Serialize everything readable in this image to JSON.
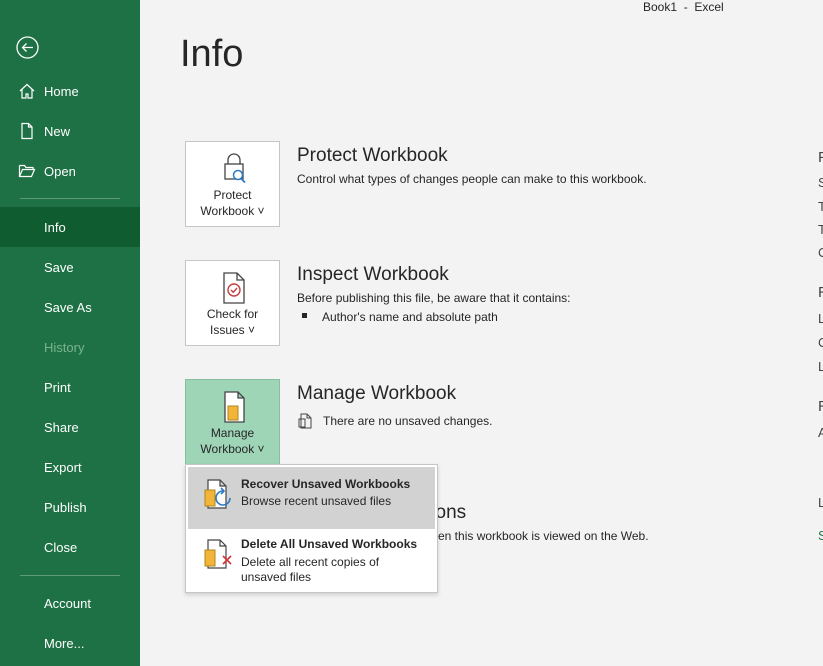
{
  "window": {
    "title": "Book1  -  Excel"
  },
  "page": {
    "title": "Info"
  },
  "sidebar": {
    "items": [
      {
        "label": "Home"
      },
      {
        "label": "New"
      },
      {
        "label": "Open"
      },
      {
        "label": "Info"
      },
      {
        "label": "Save"
      },
      {
        "label": "Save As"
      },
      {
        "label": "History"
      },
      {
        "label": "Print"
      },
      {
        "label": "Share"
      },
      {
        "label": "Export"
      },
      {
        "label": "Publish"
      },
      {
        "label": "Close"
      },
      {
        "label": "Account"
      },
      {
        "label": "More..."
      }
    ]
  },
  "sections": {
    "protect": {
      "button_line1": "Protect",
      "button_line2": "Workbook ˅",
      "title": "Protect Workbook",
      "description": "Control what types of changes people can make to this workbook."
    },
    "inspect": {
      "button_line1": "Check for",
      "button_line2": "Issues ˅",
      "title": "Inspect Workbook",
      "description": "Before publishing this file, be aware that it contains:",
      "bullets": [
        "Author's name and absolute path"
      ]
    },
    "manage": {
      "button_line1": "Manage",
      "button_line2": "Workbook ˅",
      "title": "Manage Workbook",
      "status": "There are no unsaved changes."
    },
    "browser": {
      "title_partial": "tions",
      "description_partial": "en this workbook is viewed on the Web."
    }
  },
  "menu": {
    "items": [
      {
        "title": "Recover Unsaved Workbooks",
        "description": "Browse recent unsaved files"
      },
      {
        "title": "Delete All Unsaved Workbooks",
        "description": "Delete all recent copies of unsaved files"
      }
    ]
  },
  "right_panel_clipped": [
    "P",
    "S",
    "T",
    "T",
    "C",
    "R",
    "L",
    "C",
    "L",
    "R",
    "A",
    "L",
    "S"
  ],
  "colors": {
    "sidebar": "#1e7145",
    "sidebar_active": "#0e5c2f",
    "accent": "#1e7145",
    "selected_tile": "#9fd5b7"
  }
}
